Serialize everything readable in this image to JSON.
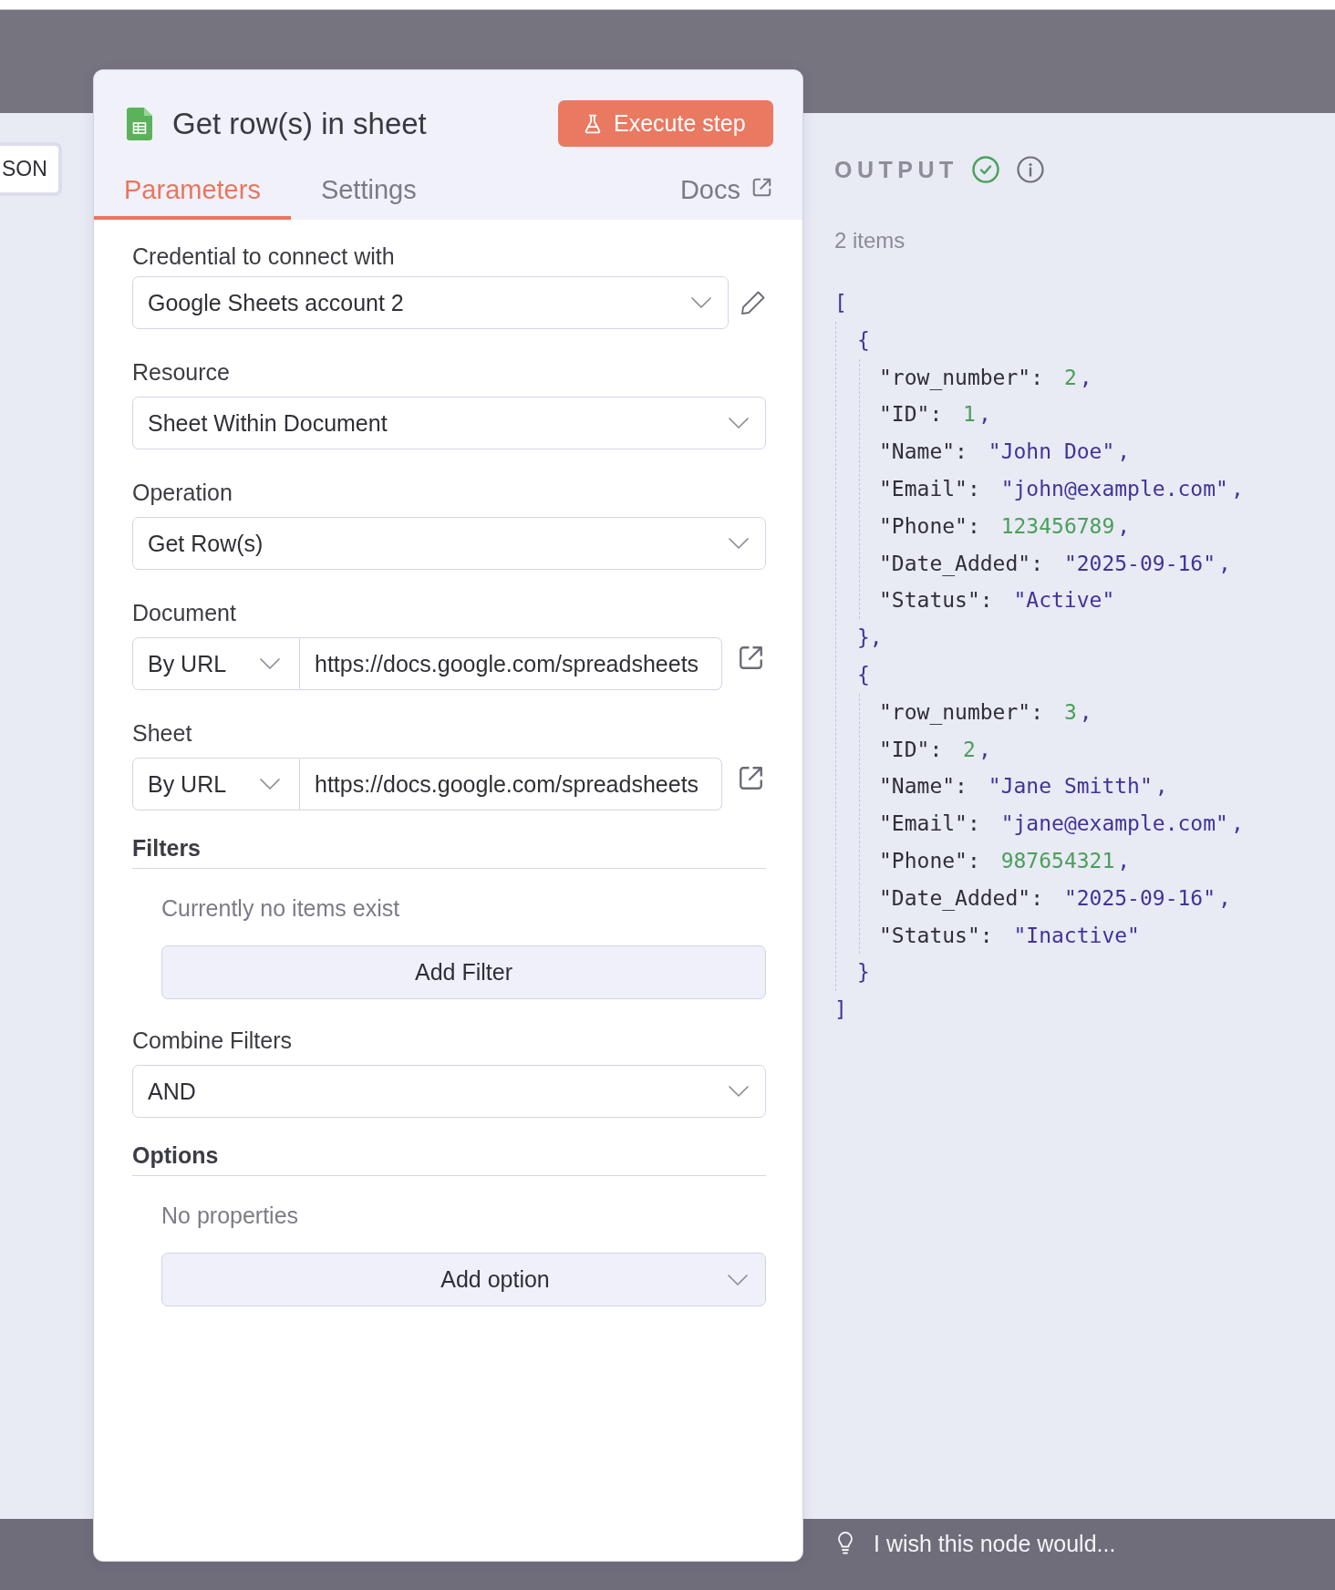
{
  "input_panel": {
    "mode_button": "SON"
  },
  "node": {
    "title": "Get row(s) in sheet",
    "execute_button": "Execute step",
    "tabs": [
      {
        "label": "Parameters",
        "selected": true
      },
      {
        "label": "Settings",
        "selected": false
      }
    ],
    "docs_link": "Docs",
    "fields": [
      {
        "kind": "credential",
        "label": "Credential to connect with",
        "value": "Google Sheets account 2"
      },
      {
        "kind": "select",
        "label": "Resource",
        "value": "Sheet Within Document"
      },
      {
        "kind": "select",
        "label": "Operation",
        "value": "Get Row(s)"
      },
      {
        "kind": "locator",
        "label": "Document",
        "mode": "By URL",
        "value": "https://docs.google.com/spreadsheets"
      },
      {
        "kind": "locator",
        "label": "Sheet",
        "mode": "By URL",
        "value": "https://docs.google.com/spreadsheets"
      },
      {
        "kind": "collection",
        "label": "Filters",
        "empty_text": "Currently no items exist",
        "button": "Add Filter"
      },
      {
        "kind": "select",
        "label": "Combine Filters",
        "value": "AND"
      },
      {
        "kind": "options",
        "label": "Options",
        "empty_text": "No properties",
        "button": "Add option"
      }
    ]
  },
  "output": {
    "title": "OUTPUT",
    "success": true,
    "count": "2 items",
    "json": {
      "open": "[",
      "close": "]",
      "children": [
        {
          "open": "{",
          "close": "},",
          "fields": [
            {
              "key": "\"row_number\":",
              "value": "2",
              "kind": "number",
              "punct": ","
            },
            {
              "key": "\"ID\":",
              "value": "1",
              "kind": "number",
              "punct": ","
            },
            {
              "key": "\"Name\":",
              "value": "\"John Doe\"",
              "kind": "string",
              "punct": ","
            },
            {
              "key": "\"Email\":",
              "value": "\"john@example.com\"",
              "kind": "string",
              "punct": ","
            },
            {
              "key": "\"Phone\":",
              "value": "123456789",
              "kind": "number",
              "punct": ","
            },
            {
              "key": "\"Date_Added\":",
              "value": "\"2025-09-16\"",
              "kind": "string",
              "punct": ","
            },
            {
              "key": "\"Status\":",
              "value": "\"Active\"",
              "kind": "string"
            }
          ]
        },
        {
          "open": "{",
          "close": "}",
          "fields": [
            {
              "key": "\"row_number\":",
              "value": "3",
              "kind": "number",
              "punct": ","
            },
            {
              "key": "\"ID\":",
              "value": "2",
              "kind": "number",
              "punct": ","
            },
            {
              "key": "\"Name\":",
              "value": "\"Jane Smitth\"",
              "kind": "string",
              "punct": ","
            },
            {
              "key": "\"Email\":",
              "value": "\"jane@example.com\"",
              "kind": "string",
              "punct": ","
            },
            {
              "key": "\"Phone\":",
              "value": "987654321",
              "kind": "number",
              "punct": ","
            },
            {
              "key": "\"Date_Added\":",
              "value": "\"2025-09-16\"",
              "kind": "string",
              "punct": ","
            },
            {
              "key": "\"Status\":",
              "value": "\"Inactive\"",
              "kind": "string"
            }
          ]
        }
      ]
    }
  },
  "footer": {
    "feedback": "I wish this node would..."
  }
}
